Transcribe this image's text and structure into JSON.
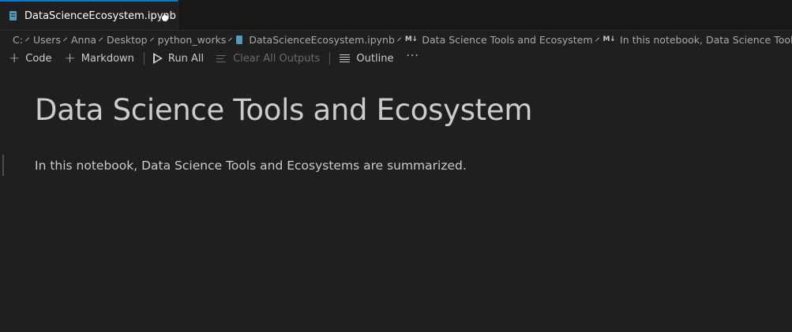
{
  "tab": {
    "label": "DataScienceEcosystem.ipynb",
    "icon": "notebook-icon"
  },
  "breadcrumb": {
    "items": [
      "C:",
      "Users",
      "Anna",
      "Desktop",
      "python_works",
      "DataScienceEcosystem.ipynb",
      "Data Science Tools and Ecosystem",
      "In this notebook, Data Science Tools and Ecosystems are summarized."
    ],
    "md_icon": "M↓"
  },
  "toolbar": {
    "code_label": "Code",
    "markdown_label": "Markdown",
    "run_all_label": "Run All",
    "clear_outputs_label": "Clear All Outputs",
    "outline_label": "Outline",
    "more_label": "···",
    "plus": "+"
  },
  "cells": {
    "heading": "Data Science Tools and Ecosystem",
    "paragraph": "In this notebook, Data Science Tools and Ecosystems are summarized."
  },
  "colors": {
    "accent": "#0078d4",
    "notebook_icon": "#519aba",
    "background": "#1f1f1f"
  }
}
